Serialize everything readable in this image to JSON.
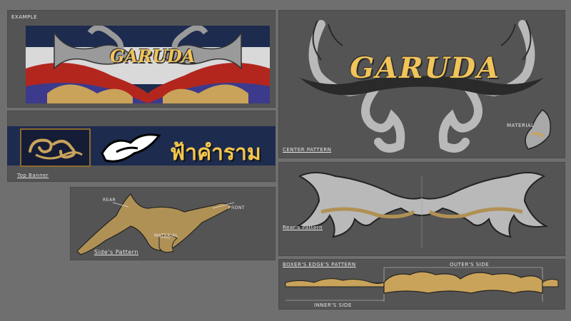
{
  "panels": {
    "example": {
      "label": "Example",
      "title": "GARUDA"
    },
    "top_banner": {
      "label": "Top Banner",
      "thai_text": "ฟ้าคำราม"
    },
    "sides_pattern": {
      "label": "Side's Pattern",
      "rear": "Rear",
      "front": "Front",
      "material": "Material"
    },
    "center_pattern": {
      "label": "Center Pattern",
      "title": "GARUDA",
      "material": "Material"
    },
    "rears_pattern": {
      "label": "Rear's Pattern"
    },
    "boxers_edges_pattern": {
      "label": "Boxer's Edge's Pattern",
      "outer_side": "Outer's Side",
      "inner_side": "Inner's Side"
    }
  },
  "colors": {
    "background": "#6f6f6f",
    "panel": "#545454",
    "gold": "#c9a35a",
    "silver": "#b9b9b9",
    "navy": "#1d2b4f",
    "red": "#b3261e",
    "yellow_text": "#f1c45a"
  }
}
